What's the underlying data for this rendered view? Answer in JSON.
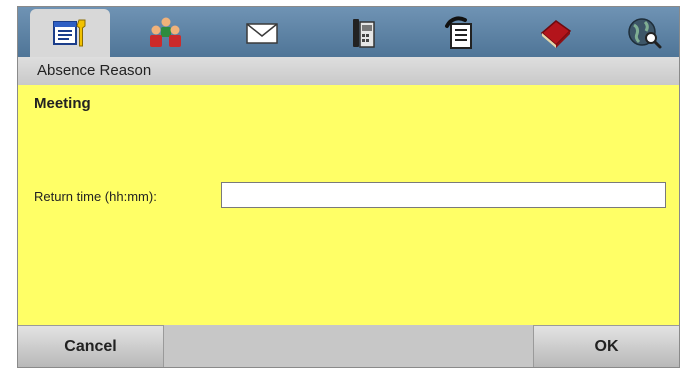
{
  "tabs": [
    {
      "icon": "settings-form-icon",
      "active": true
    },
    {
      "icon": "people-icon",
      "active": false
    },
    {
      "icon": "envelope-icon",
      "active": false
    },
    {
      "icon": "desk-phone-icon",
      "active": false
    },
    {
      "icon": "call-list-icon",
      "active": false
    },
    {
      "icon": "phonebook-icon",
      "active": false
    },
    {
      "icon": "globe-search-icon",
      "active": false
    }
  ],
  "header": {
    "title": "Absence Reason"
  },
  "main": {
    "heading": "Meeting",
    "return_time_label": "Return time (hh:mm):",
    "return_time_value": ""
  },
  "footer": {
    "cancel_label": "Cancel",
    "ok_label": "OK"
  },
  "colors": {
    "tabbar": "#5f84a6",
    "content_background": "#ffff66",
    "bar_gray": "#c7c7c7"
  }
}
